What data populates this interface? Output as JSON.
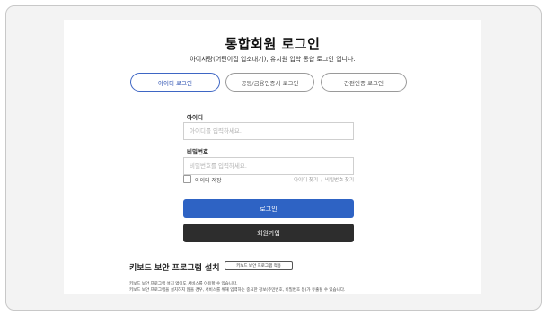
{
  "page": {
    "title": "통합회원 로그인",
    "subtitle": "아이사랑(어린이집 입소대기), 유치원 입학 통합 로그인 입니다."
  },
  "tabs": [
    {
      "label": "아이디 로그인",
      "active": true
    },
    {
      "label": "공동/금융인증서 로그인",
      "active": false
    },
    {
      "label": "간편인증 로그인",
      "active": false
    }
  ],
  "form": {
    "id_label": "아이디",
    "id_placeholder": "아이디를 입력하세요.",
    "pw_label": "비밀번호",
    "pw_placeholder": "비밀번호를 입력하세요.",
    "save_id_label": "아이디 저장",
    "find_id_link": "아이디 찾기",
    "link_separator": "/",
    "find_pw_link": "비밀번호 찾기",
    "login_button": "로그인",
    "join_button": "회원가입"
  },
  "keyboard": {
    "title": "키보드 보안 프로그램 설치",
    "manual_button": "키보드 보안 프로그램 적용",
    "desc_line1": "키보드 보안 프로그램 설치 없이도 서비스를 이용할 수 있습니다.",
    "desc_line2": "키보드 보안 프로그램을 설치하지 않을 경우, 서비스를 위해 입력하는 중요한 정보(주민번호, 비밀번호 등)가 유출될 수 있습니다."
  },
  "colors": {
    "primary": "#2e63c4",
    "dark_button": "#2d2d2d",
    "background": "#f3f3f3"
  }
}
